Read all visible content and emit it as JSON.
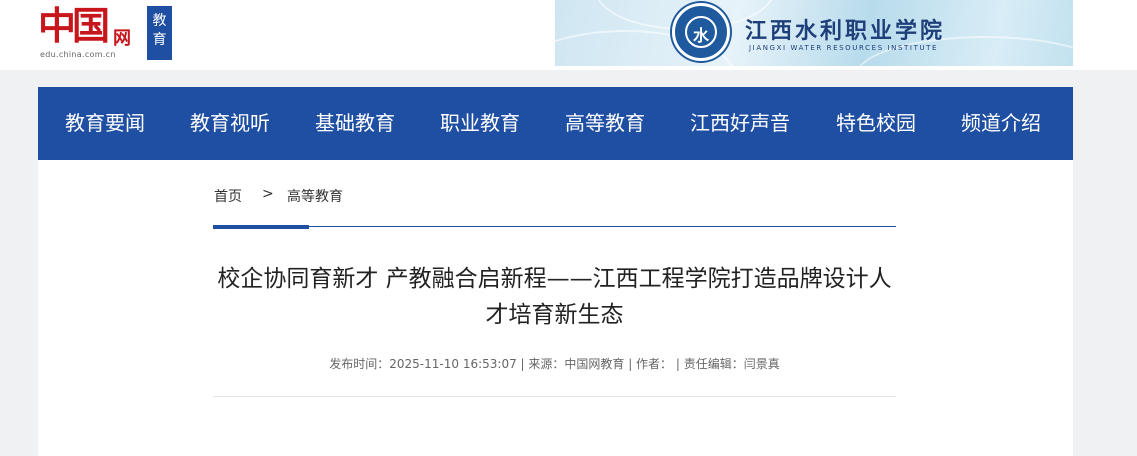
{
  "logo": {
    "brand": "中国",
    "brand_suffix": "网",
    "url_text": "edu.china.com.cn",
    "channel": "教育"
  },
  "banner": {
    "seal_char": "水",
    "title": "江西水利职业学院",
    "subtitle": "JIANGXI WATER RESOURCES INSTITUTE"
  },
  "nav": {
    "items": [
      {
        "label": "教育要闻"
      },
      {
        "label": "教育视听"
      },
      {
        "label": "基础教育"
      },
      {
        "label": "职业教育"
      },
      {
        "label": "高等教育"
      },
      {
        "label": "江西好声音"
      },
      {
        "label": "特色校园"
      },
      {
        "label": "频道介绍"
      }
    ]
  },
  "breadcrumb": {
    "home": "首页",
    "separator": ">",
    "current": "高等教育"
  },
  "article": {
    "title": "校企协同育新才 产教融合启新程——江西工程学院打造品牌设计人才培育新生态",
    "meta": "发布时间：2025-11-10 16:53:07 | 来源：中国网教育 | 作者：  | 责任编辑：闫景真"
  },
  "colors": {
    "nav_blue": "#1f4fa3",
    "brand_red": "#c8161d",
    "page_bg": "#f0f1f3"
  }
}
